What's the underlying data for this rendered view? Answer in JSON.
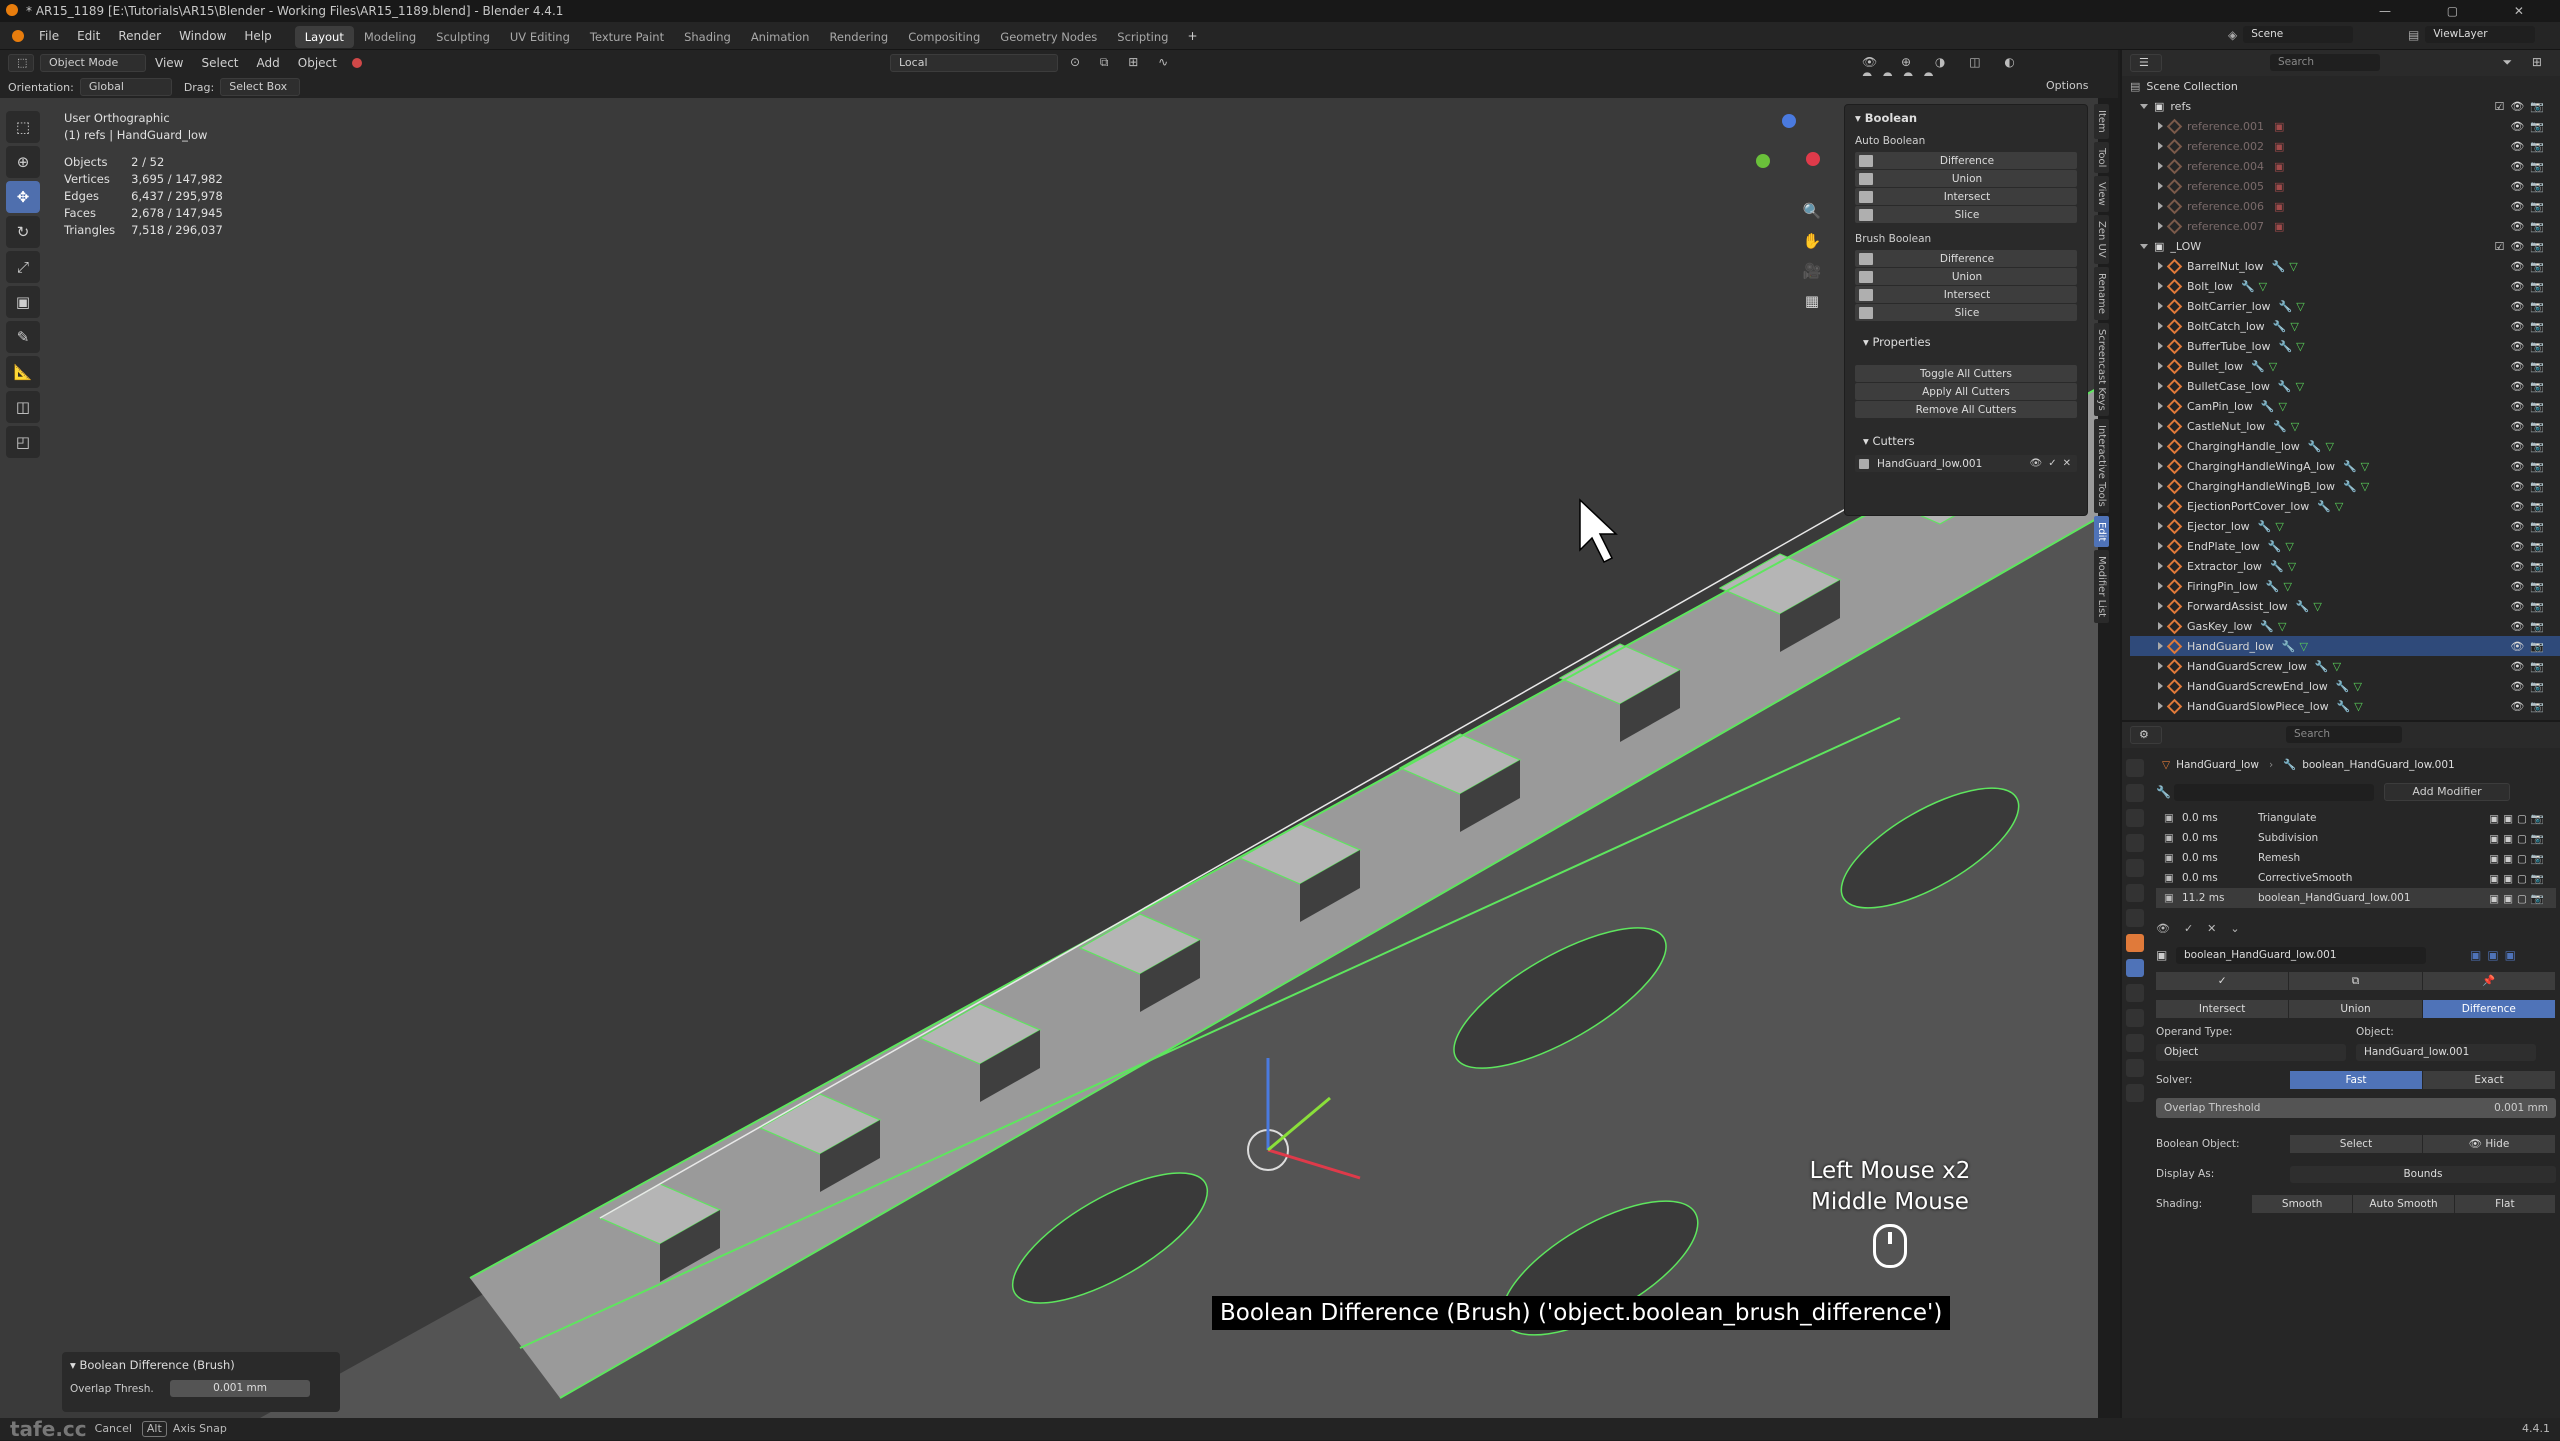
{
  "titlebar": {
    "title": "* AR15_1189 [E:\\Tutorials\\AR15\\Blender - Working Files\\AR15_1189.blend] - Blender 4.4.1"
  },
  "menu": [
    "File",
    "Edit",
    "Render",
    "Window",
    "Help"
  ],
  "workspaces": [
    "Layout",
    "Modeling",
    "Sculpting",
    "UV Editing",
    "Texture Paint",
    "Shading",
    "Animation",
    "Rendering",
    "Compositing",
    "Geometry Nodes",
    "Scripting"
  ],
  "active_workspace": "Layout",
  "scene": {
    "scene_label": "Scene",
    "viewlayer_label": "ViewLayer"
  },
  "viewport_header": {
    "mode": "Object Mode",
    "menus": [
      "View",
      "Select",
      "Add",
      "Object"
    ],
    "transform_orientation": "Local",
    "orientation_label": "Orientation:",
    "orientation_value": "Global",
    "drag_label": "Drag:",
    "drag_value": "Select Box",
    "options": "Options"
  },
  "viewport_info": {
    "view_name": "User Orthographic",
    "collection": "(1) refs | HandGuard_low",
    "stats": [
      {
        "label": "Objects",
        "value": "2 / 52"
      },
      {
        "label": "Vertices",
        "value": "3,695 / 147,982"
      },
      {
        "label": "Edges",
        "value": "6,437 / 295,978"
      },
      {
        "label": "Faces",
        "value": "2,678 / 147,945"
      },
      {
        "label": "Triangles",
        "value": "7,518 / 296,037"
      }
    ]
  },
  "npanel": {
    "title": "Boolean",
    "auto_boolean": "Auto Boolean",
    "auto_ops": [
      "Difference",
      "Union",
      "Intersect",
      "Slice"
    ],
    "brush_boolean": "Brush Boolean",
    "brush_ops": [
      "Difference",
      "Union",
      "Intersect",
      "Slice"
    ],
    "properties": "Properties",
    "prop_ops": [
      "Toggle All Cutters",
      "Apply All Cutters",
      "Remove All Cutters"
    ],
    "cutters": "Cutters",
    "cutter_item": "HandGuard_low.001"
  },
  "side_tabs": [
    "Item",
    "Tool",
    "View",
    "Zen UV",
    "Rename",
    "Screencast Keys",
    "Interactive Tools",
    "Edit",
    "Modifier List"
  ],
  "outliner": {
    "root": "Scene Collection",
    "search_placeholder": "Search",
    "refs_collection": "refs",
    "refs_items": [
      "reference.001",
      "reference.002",
      "reference.004",
      "reference.005",
      "reference.006",
      "reference.007"
    ],
    "low_collection": "_LOW",
    "low_items": [
      "BarrelNut_low",
      "Bolt_low",
      "BoltCarrier_low",
      "BoltCatch_low",
      "BufferTube_low",
      "Bullet_low",
      "BulletCase_low",
      "CamPin_low",
      "CastleNut_low",
      "ChargingHandle_low",
      "ChargingHandleWingA_low",
      "ChargingHandleWingB_low",
      "EjectionPortCover_low",
      "Ejector_low",
      "EndPlate_low",
      "Extractor_low",
      "FiringPin_low",
      "ForwardAssist_low",
      "GasKey_low",
      "HandGuard_low",
      "HandGuardScrew_low",
      "HandGuardScrewEnd_low",
      "HandGuardSlowPiece_low"
    ],
    "selected_item": "HandGuard_low"
  },
  "properties": {
    "search_placeholder": "Search",
    "breadcrumb_object": "HandGuard_low",
    "breadcrumb_modifier": "boolean_HandGuard_low.001",
    "add_modifier": "Add Modifier",
    "modifiers": [
      {
        "time": "0.0 ms",
        "name": "Triangulate"
      },
      {
        "time": "0.0 ms",
        "name": "Subdivision"
      },
      {
        "time": "0.0 ms",
        "name": "Remesh"
      },
      {
        "time": "0.0 ms",
        "name": "CorrectiveSmooth"
      },
      {
        "time": "11.2 ms",
        "name": "boolean_HandGuard_low.001"
      }
    ],
    "active_modifier_name": "boolean_HandGuard_low.001",
    "operation_buttons": [
      "Intersect",
      "Union",
      "Difference"
    ],
    "active_operation": "Difference",
    "operand_type_label": "Operand Type:",
    "object_label": "Object:",
    "operand_type_value": "Object",
    "object_value": "HandGuard_low.001",
    "solver_label": "Solver:",
    "solver_options": [
      "Fast",
      "Exact"
    ],
    "active_solver": "Fast",
    "overlap_label": "Overlap Threshold",
    "overlap_value": "0.001 mm",
    "boolean_object_label": "Boolean Object:",
    "boolean_object_select": "Select",
    "boolean_object_hide": "Hide",
    "display_as_label": "Display As:",
    "display_as_value": "Bounds",
    "shading_label": "Shading:",
    "shading_options": [
      "Smooth",
      "Auto Smooth",
      "Flat"
    ]
  },
  "overlays": {
    "keys_line1": "Left Mouse x2",
    "keys_line2": "Middle Mouse",
    "operator": "Boolean Difference (Brush) ('object.boolean_brush_difference')"
  },
  "redo_panel": {
    "title": "Boolean Difference (Brush)",
    "overlap_label": "Overlap Thresh.",
    "overlap_value": "0.001 mm"
  },
  "statusbar": {
    "cancel": "Cancel",
    "axis_snap": "Axis Snap",
    "alt_key": "Alt",
    "version": "4.4.1",
    "watermark": "tafe.cc"
  },
  "colors": {
    "accent": "#4f73b8",
    "selection": "#2f4a7a",
    "mesh_icon": "#e07a3a",
    "wire": "#5ee65e",
    "viewport": "#3b3b3b"
  }
}
